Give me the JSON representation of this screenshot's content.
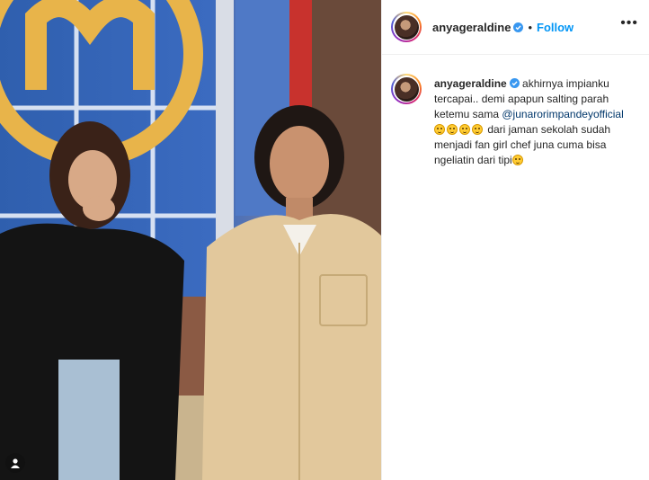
{
  "header": {
    "username": "anyageraldine",
    "separator": "•",
    "follow_label": "Follow",
    "more_label": "•••"
  },
  "caption": {
    "username": "anyageraldine",
    "text_1": " akhirnya impianku tercapai.. demi apapun salting parah ketemu sama ",
    "mention": "@junarorimpandeyofficial",
    "text_2": " dari jaman sekolah sudah menjadi fan girl chef juna cuma bisa ngeliatin dari tipi"
  },
  "colors": {
    "link": "#0095f6",
    "mention": "#00376b",
    "verified": "#3897f0"
  },
  "icons": [
    "verified-badge-icon",
    "more-options-icon",
    "tagged-user-icon",
    "smile-emoji-icon"
  ]
}
